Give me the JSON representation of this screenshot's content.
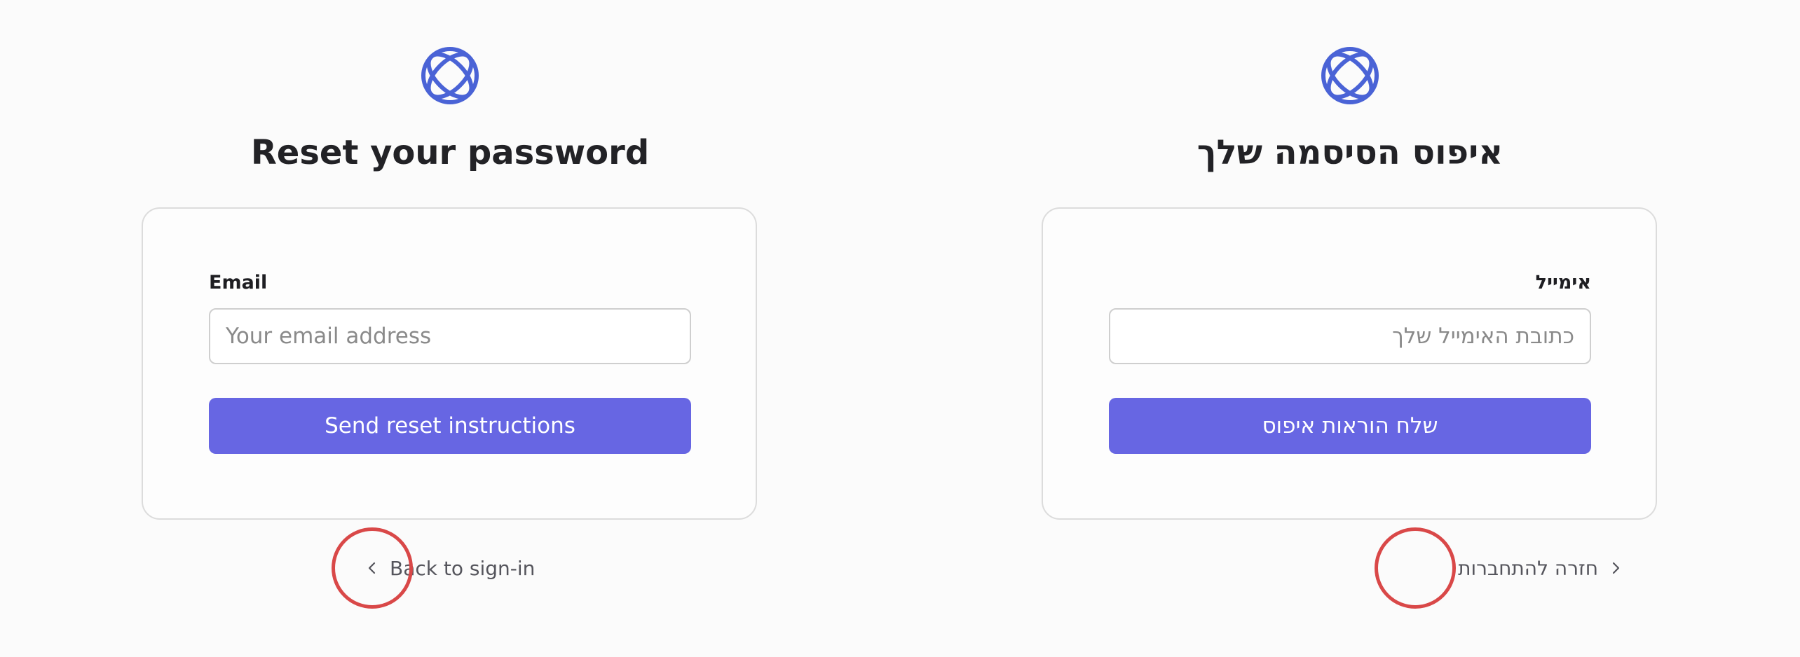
{
  "theme": {
    "accent": "#6766e3",
    "logo_color": "#4a63d6",
    "highlight": "#d94848"
  },
  "ltr": {
    "logo": "globe-logo",
    "title": "Reset your password",
    "email_label": "Email",
    "email_value": "",
    "email_placeholder": "Your email address",
    "submit_label": "Send reset instructions",
    "back_icon": "chevron-left-icon",
    "back_label": "Back to sign-in"
  },
  "rtl": {
    "logo": "globe-logo",
    "title": "איפוס הסיסמה שלך",
    "email_label": "אימייל",
    "email_value": "",
    "email_placeholder": "כתובת האימייל שלך",
    "submit_label": "שלח הוראות איפוס",
    "back_icon": "chevron-right-icon",
    "back_label": "חזרה להתחברות"
  }
}
